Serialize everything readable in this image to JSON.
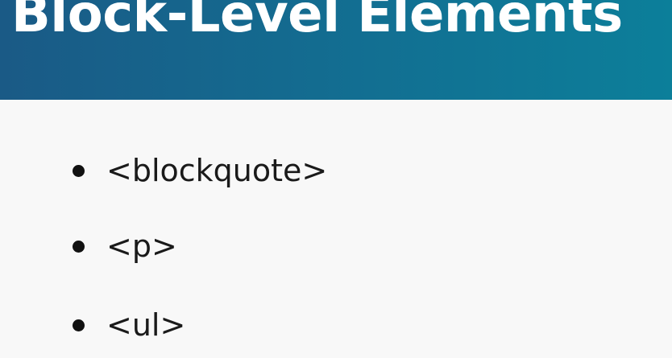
{
  "slide": {
    "title": "Block-Level Elements",
    "bullets": [
      {
        "label": "<blockquote>"
      },
      {
        "label": "<p>"
      },
      {
        "label": "<ul>"
      }
    ]
  },
  "colors": {
    "header_gradient_start": "#1a5a86",
    "header_gradient_end": "#0c7f9a",
    "title_text": "#ffffff",
    "body_background": "#f8f8f8",
    "body_text": "#1a1a1a"
  }
}
